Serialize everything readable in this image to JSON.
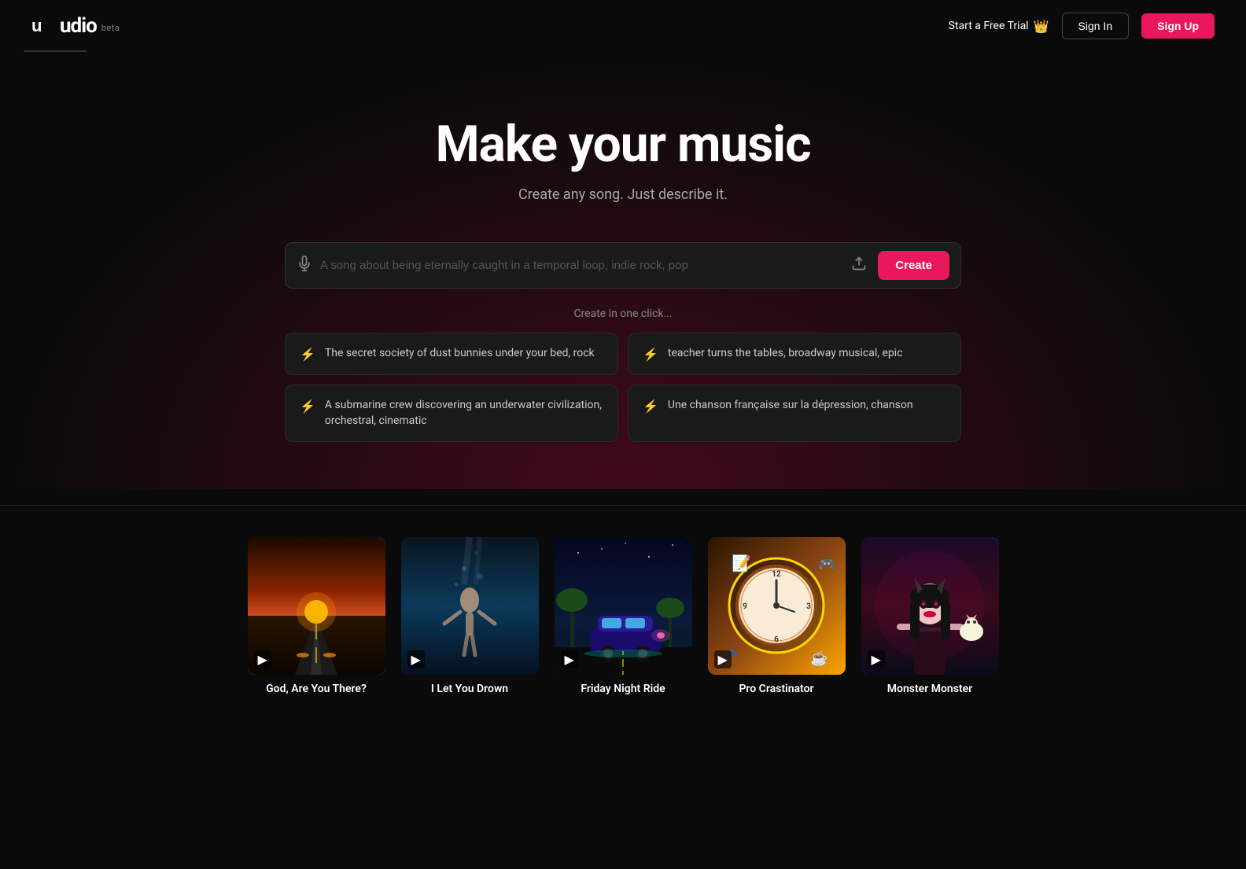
{
  "navbar": {
    "logo_text": "udio",
    "beta_label": "beta",
    "free_trial_label": "Start a Free Trial",
    "sign_in_label": "Sign In",
    "sign_up_label": "Sign Up",
    "crown_icon": "👑"
  },
  "hero": {
    "title": "Make your music",
    "subtitle": "Create any song. Just describe it.",
    "search_placeholder": "A song about being eternally caught in a temporal loop, indie rock, pop",
    "create_button_label": "Create",
    "one_click_label": "Create in one click..."
  },
  "suggestions": [
    {
      "id": 1,
      "text": "The secret society of dust bunnies under your bed, rock"
    },
    {
      "id": 2,
      "text": "teacher turns the tables, broadway musical, epic"
    },
    {
      "id": 3,
      "text": "A submarine crew discovering an underwater civilization, orchestral, cinematic"
    },
    {
      "id": 4,
      "text": "Une chanson française sur la dépression, chanson"
    }
  ],
  "music_cards": [
    {
      "id": 1,
      "title": "God, Are You There?",
      "theme": "card-god",
      "emoji": "🌅"
    },
    {
      "id": 2,
      "title": "I Let You Drown",
      "theme": "card-drown",
      "emoji": "🌊"
    },
    {
      "id": 3,
      "title": "Friday Night Ride",
      "theme": "card-friday",
      "emoji": "🌴"
    },
    {
      "id": 4,
      "title": "Pro Crastinator",
      "theme": "card-procrastinator",
      "emoji": "⏰"
    },
    {
      "id": 5,
      "title": "Monster Monster",
      "theme": "card-monster",
      "emoji": "👹"
    }
  ],
  "icons": {
    "lightning": "⚡",
    "upload": "↑",
    "mic": "🎤",
    "play": "▶"
  }
}
